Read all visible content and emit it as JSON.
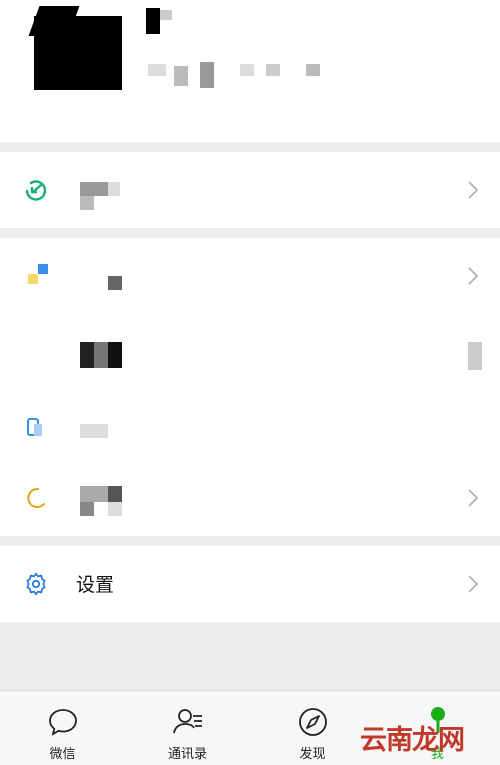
{
  "profile": {
    "avatar_alt": "avatar",
    "name": "",
    "id": ""
  },
  "menu": {
    "group1": [
      {
        "icon": "pay-icon",
        "label": ""
      }
    ],
    "group2": [
      {
        "icon": "favorites-icon",
        "label": ""
      },
      {
        "icon": "album-icon",
        "label": ""
      },
      {
        "icon": "cards-icon",
        "label": ""
      },
      {
        "icon": "sticker-icon",
        "label": ""
      }
    ],
    "group3": [
      {
        "icon": "settings-icon",
        "label": "设置"
      }
    ]
  },
  "tabs": [
    {
      "icon": "chat-bubble-icon",
      "label": "微信"
    },
    {
      "icon": "contacts-icon",
      "label": "通讯录"
    },
    {
      "icon": "compass-icon",
      "label": "发现"
    },
    {
      "icon": "me-icon",
      "label": "我"
    }
  ],
  "watermark": "云南龙网",
  "colors": {
    "active": "#1aad19",
    "settings_icon": "#2b7bd6"
  }
}
